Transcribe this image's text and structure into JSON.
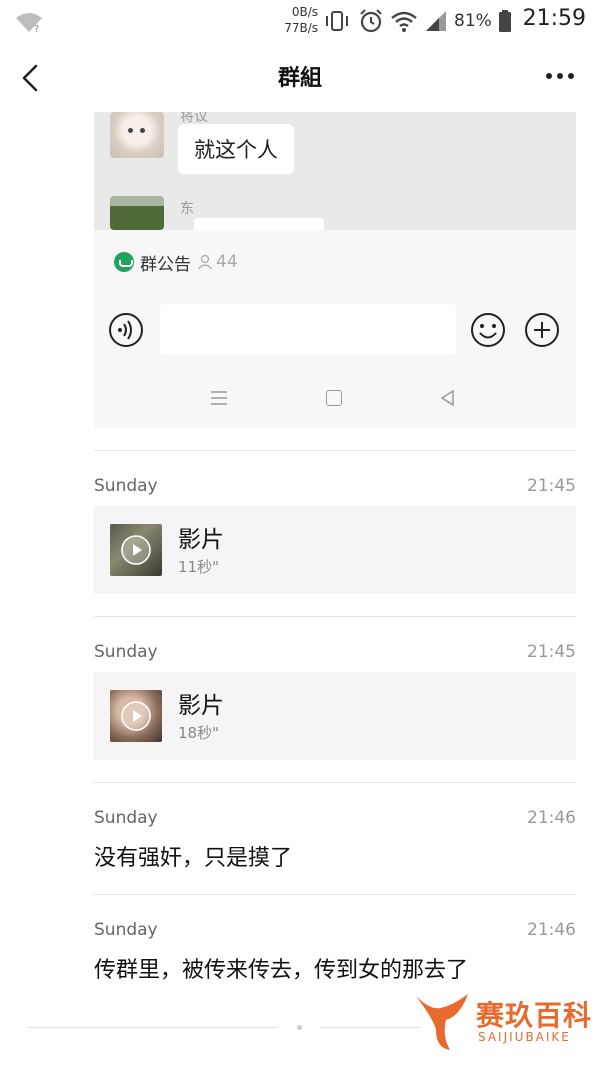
{
  "status_bar": {
    "net_down": "0B/s",
    "net_up": "77B/s",
    "battery": "81%",
    "time": "21:59",
    "icons": [
      "wifi-question-icon",
      "vibrate-icon",
      "alarm-icon",
      "wifi-icon",
      "signal-icon",
      "battery-icon"
    ]
  },
  "header": {
    "title": "群組"
  },
  "embedded_screenshot": {
    "sender_1": "将议",
    "bubble_text": "就这个人",
    "sender_2": "东",
    "notice_label": "群公告",
    "member_count": "44"
  },
  "messages": [
    {
      "day": "Sunday",
      "time": "21:45",
      "type": "video",
      "title": "影片",
      "duration": "11秒\""
    },
    {
      "day": "Sunday",
      "time": "21:45",
      "type": "video",
      "title": "影片",
      "duration": "18秒\""
    },
    {
      "day": "Sunday",
      "time": "21:46",
      "type": "text",
      "text": "没有强奸，只是摸了"
    },
    {
      "day": "Sunday",
      "time": "21:46",
      "type": "text",
      "text": "传群里，被传来传去，传到女的那去了"
    }
  ],
  "watermark": {
    "text": "赛玖百科",
    "sub": "SAIJIUBAIKE"
  },
  "colors": {
    "notice_green": "#20a45c",
    "watermark_orange": "#e86a2e"
  }
}
